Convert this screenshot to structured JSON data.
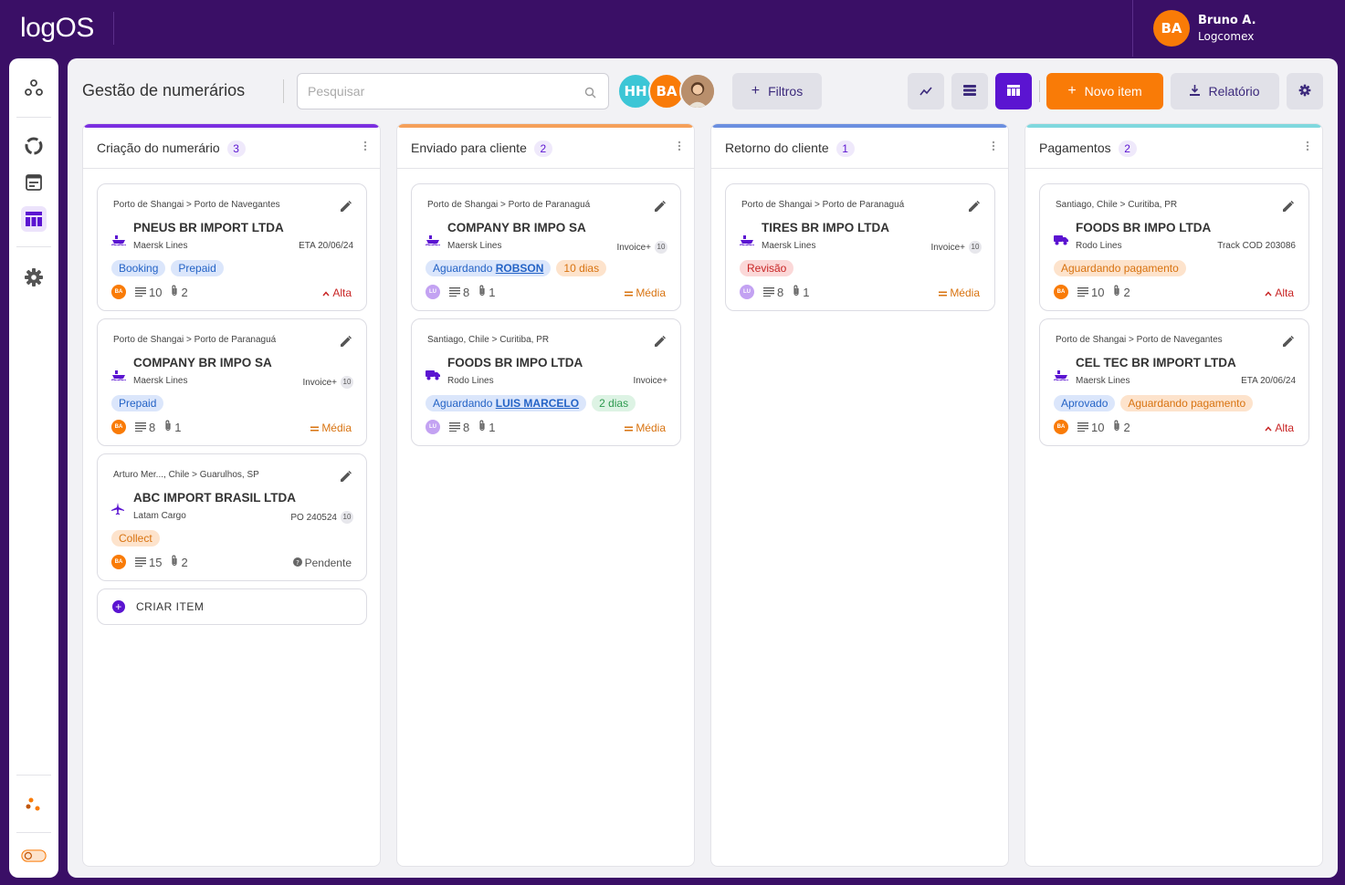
{
  "app": {
    "logo": "logOS"
  },
  "user": {
    "initials": "BA",
    "name": "Bruno A.",
    "company": "Logcomex"
  },
  "page": {
    "title": "Gestão de numerários"
  },
  "search": {
    "placeholder": "Pesquisar"
  },
  "team_avatars": [
    {
      "initials": "HH",
      "color": "#3cc6d6"
    },
    {
      "initials": "BA",
      "color": "#f97b07"
    },
    {
      "initials": "",
      "type": "photo"
    }
  ],
  "toolbar": {
    "filters_label": "Filtros",
    "new_item_label": "Novo item",
    "report_label": "Relatório",
    "active_view": "board"
  },
  "colors": {
    "brand": "#3a0f66",
    "accent": "#5b14d1",
    "orange": "#f97b07"
  },
  "columns": [
    {
      "title": "Criação do numerário",
      "count": "3",
      "color": "#7b2fe0",
      "create_label": "CRIAR ITEM",
      "cards": [
        {
          "route": "Porto de Shangai  >  Porto de Navegantes",
          "client": "PNEUS BR IMPORT LTDA",
          "mode": "ship",
          "carrier": "Maersk Lines",
          "ref": "ETA 20/06/24",
          "ref_badge": "",
          "tags": [
            {
              "label": "Booking",
              "style": "blue"
            },
            {
              "label": "Prepaid",
              "style": "blue"
            }
          ],
          "assignee": "BA",
          "docs": "10",
          "attachments": "2",
          "priority": "Alta"
        },
        {
          "route": "Porto de Shangai  >  Porto de Paranaguá",
          "client": "COMPANY BR IMPO SA",
          "mode": "ship",
          "carrier": "Maersk Lines",
          "ref": "Invoice+",
          "ref_badge": "10",
          "tags": [
            {
              "label": "Prepaid",
              "style": "blue"
            }
          ],
          "assignee": "BA",
          "docs": "8",
          "attachments": "1",
          "priority": "Média"
        },
        {
          "route": "Arturo Mer..., Chile  >  Guarulhos, SP",
          "client": "ABC IMPORT BRASIL LTDA",
          "mode": "plane",
          "carrier": "Latam Cargo",
          "ref": "PO 240524",
          "ref_badge": "10",
          "tags": [
            {
              "label": "Collect",
              "style": "orange"
            }
          ],
          "assignee": "BA",
          "docs": "15",
          "attachments": "2",
          "priority": "Pendente"
        }
      ]
    },
    {
      "title": "Enviado para cliente",
      "count": "2",
      "color": "#f5a05a",
      "cards": [
        {
          "route": "Porto de Shangai  >  Porto de Paranaguá",
          "client": "COMPANY BR IMPO SA",
          "mode": "ship",
          "carrier": "Maersk Lines",
          "ref": "Invoice+",
          "ref_badge": "10",
          "tags": [
            {
              "label": "Aguardando",
              "bold": "ROBSON",
              "style": "blue"
            },
            {
              "label": "10 dias",
              "style": "orange"
            }
          ],
          "assignee": "LU",
          "docs": "8",
          "attachments": "1",
          "priority": "Média"
        },
        {
          "route": "Santiago, Chile  >  Curitiba, PR",
          "client": "FOODS BR IMPO LTDA",
          "mode": "truck",
          "carrier": "Rodo Lines",
          "ref": "Invoice+",
          "ref_badge": "",
          "tags": [
            {
              "label": "Aguardando",
              "bold": "LUIS MARCELO",
              "style": "blue"
            },
            {
              "label": "2 dias",
              "style": "green"
            }
          ],
          "assignee": "LU",
          "docs": "8",
          "attachments": "1",
          "priority": "Média"
        }
      ]
    },
    {
      "title": "Retorno do cliente",
      "count": "1",
      "color": "#6b8fe0",
      "cards": [
        {
          "route": "Porto de Shangai  >  Porto de Paranaguá",
          "client": "TIRES BR IMPO LTDA",
          "mode": "ship",
          "carrier": "Maersk Lines",
          "ref": "Invoice+",
          "ref_badge": "10",
          "tags": [
            {
              "label": "Revisão",
              "style": "red"
            }
          ],
          "assignee": "LU",
          "docs": "8",
          "attachments": "1",
          "priority": "Média"
        }
      ]
    },
    {
      "title": "Pagamentos",
      "count": "2",
      "color": "#7fd8de",
      "cards": [
        {
          "route": "Santiago, Chile  >  Curitiba, PR",
          "client": "FOODS BR IMPO LTDA",
          "mode": "truck",
          "carrier": "Rodo Lines",
          "ref": "Track COD 203086",
          "ref_badge": "",
          "tags": [
            {
              "label": "Aguardando pagamento",
              "style": "orange"
            }
          ],
          "assignee": "BA",
          "docs": "10",
          "attachments": "2",
          "priority": "Alta"
        },
        {
          "route": "Porto de Shangai  >  Porto de Navegantes",
          "client": "CEL TEC BR IMPORT LTDA",
          "mode": "ship",
          "carrier": "Maersk Lines",
          "ref": "ETA 20/06/24",
          "ref_badge": "",
          "tags": [
            {
              "label": "Aprovado",
              "style": "blue"
            },
            {
              "label": "Aguardando pagamento",
              "style": "orange"
            }
          ],
          "assignee": "BA",
          "docs": "10",
          "attachments": "2",
          "priority": "Alta"
        }
      ]
    }
  ]
}
